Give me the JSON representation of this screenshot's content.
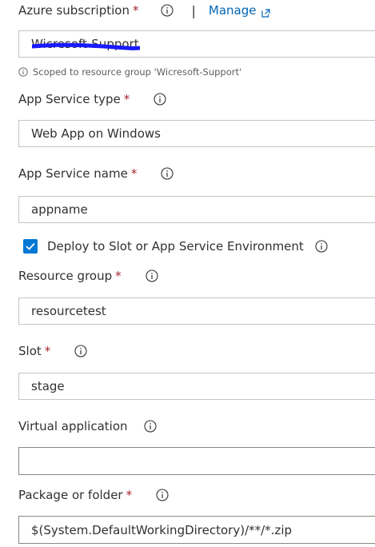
{
  "azure_subscription": {
    "label": "Azure subscription",
    "required_mark": "*",
    "separator": "|",
    "manage_label": "Manage",
    "value": "Wicresoft-Support",
    "helper_text": "Scoped to resource group 'Wicresoft-Support'"
  },
  "app_service_type": {
    "label": "App Service type",
    "required_mark": "*",
    "value": "Web App on Windows"
  },
  "app_service_name": {
    "label": "App Service name",
    "required_mark": "*",
    "value": "appname"
  },
  "deploy_to_slot": {
    "label": "Deploy to Slot or App Service Environment",
    "checked": true
  },
  "resource_group": {
    "label": "Resource group",
    "required_mark": "*",
    "value": "resourcetest"
  },
  "slot": {
    "label": "Slot",
    "required_mark": "*",
    "value": "stage"
  },
  "virtual_application": {
    "label": "Virtual application",
    "value": ""
  },
  "package_or_folder": {
    "label": "Package or folder",
    "required_mark": "*",
    "value": "$(System.DefaultWorkingDirectory)/**/*.zip"
  },
  "colors": {
    "accent": "#0078d4",
    "link": "#0066b4",
    "required": "#a4262c",
    "redaction": "#1a1aff",
    "border": "#c8c6c4"
  }
}
